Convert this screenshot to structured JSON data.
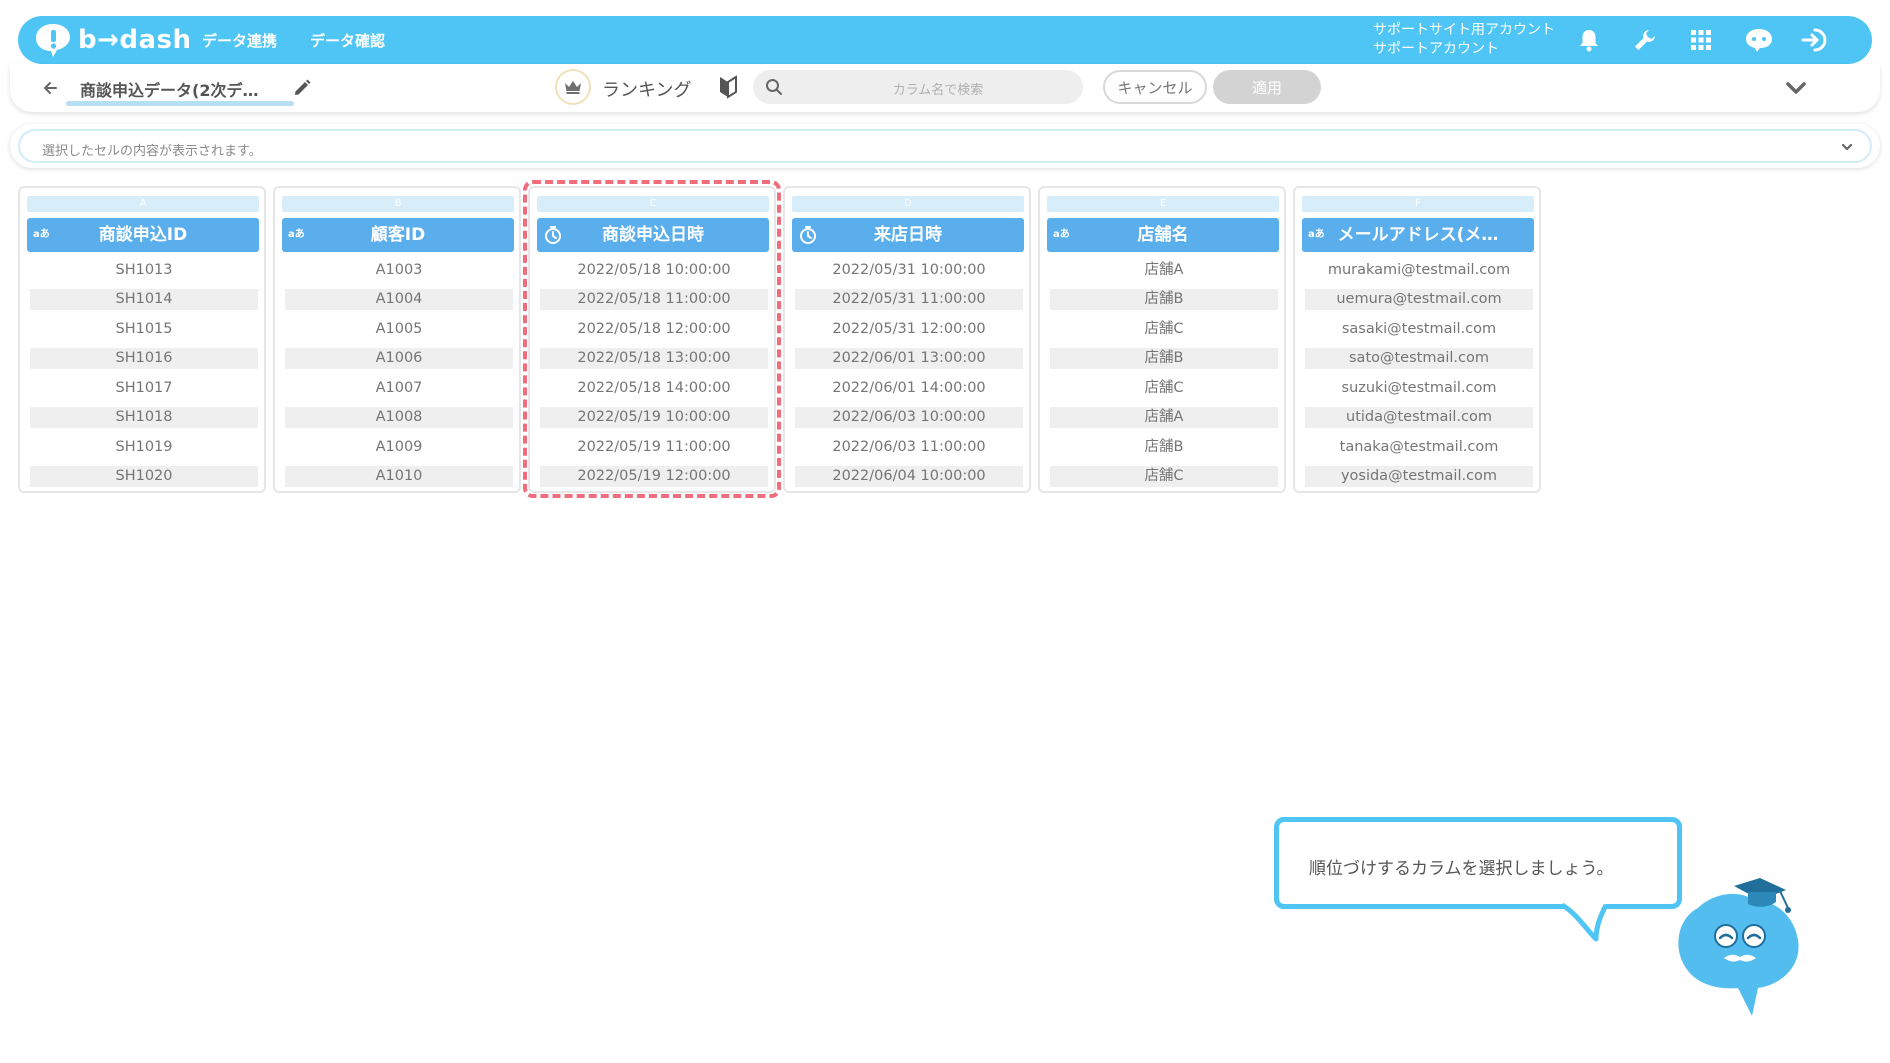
{
  "header": {
    "logo_text": "b→dash",
    "nav": [
      "データ連携",
      "データ確認"
    ],
    "account_line1": "サポートサイト用アカウント",
    "account_line2": "サポートアカウント",
    "icons": [
      "bell-icon",
      "wrench-icon",
      "grid-icon",
      "chat-icon",
      "logout-icon"
    ]
  },
  "subbar": {
    "title": "商談申込データ(2次デ…",
    "ranking_label": "ランキング",
    "search_placeholder": "カラム名で検索",
    "cancel_label": "キャンセル",
    "apply_label": "適用"
  },
  "cellbar": {
    "placeholder": "選択したセルの内容が表示されます。"
  },
  "columns": [
    {
      "letter": "A",
      "type": "text",
      "title": "商談申込ID",
      "cells": [
        "SH1013",
        "SH1014",
        "SH1015",
        "SH1016",
        "SH1017",
        "SH1018",
        "SH1019",
        "SH1020"
      ]
    },
    {
      "letter": "B",
      "type": "text",
      "title": "顧客ID",
      "cells": [
        "A1003",
        "A1004",
        "A1005",
        "A1006",
        "A1007",
        "A1008",
        "A1009",
        "A1010"
      ]
    },
    {
      "letter": "C",
      "type": "datetime",
      "title": "商談申込日時",
      "cells": [
        "2022/05/18 10:00:00",
        "2022/05/18 11:00:00",
        "2022/05/18 12:00:00",
        "2022/05/18 13:00:00",
        "2022/05/18 14:00:00",
        "2022/05/19 10:00:00",
        "2022/05/19 11:00:00",
        "2022/05/19 12:00:00"
      ]
    },
    {
      "letter": "D",
      "type": "datetime",
      "title": "来店日時",
      "cells": [
        "2022/05/31 10:00:00",
        "2022/05/31 11:00:00",
        "2022/05/31 12:00:00",
        "2022/06/01 13:00:00",
        "2022/06/01 14:00:00",
        "2022/06/03 10:00:00",
        "2022/06/03 11:00:00",
        "2022/06/04 10:00:00"
      ]
    },
    {
      "letter": "E",
      "type": "text",
      "title": "店舗名",
      "cells": [
        "店舗A",
        "店舗B",
        "店舗C",
        "店舗B",
        "店舗C",
        "店舗A",
        "店舗B",
        "店舗C"
      ]
    },
    {
      "letter": "F",
      "type": "text",
      "title": "メールアドレス(メ…",
      "cells": [
        "murakami@testmail.com",
        "uemura@testmail.com",
        "sasaki@testmail.com",
        "sato@testmail.com",
        "suzuki@testmail.com",
        "utida@testmail.com",
        "tanaka@testmail.com",
        "yosida@testmail.com"
      ]
    }
  ],
  "type_icon_text": "aあ",
  "tooltip": {
    "text": "順位づけするカラムを選択しましょう。"
  },
  "colors": {
    "brand": "#4ec5f4",
    "column_header": "#5aaeec",
    "highlight": "#f06d7d"
  }
}
